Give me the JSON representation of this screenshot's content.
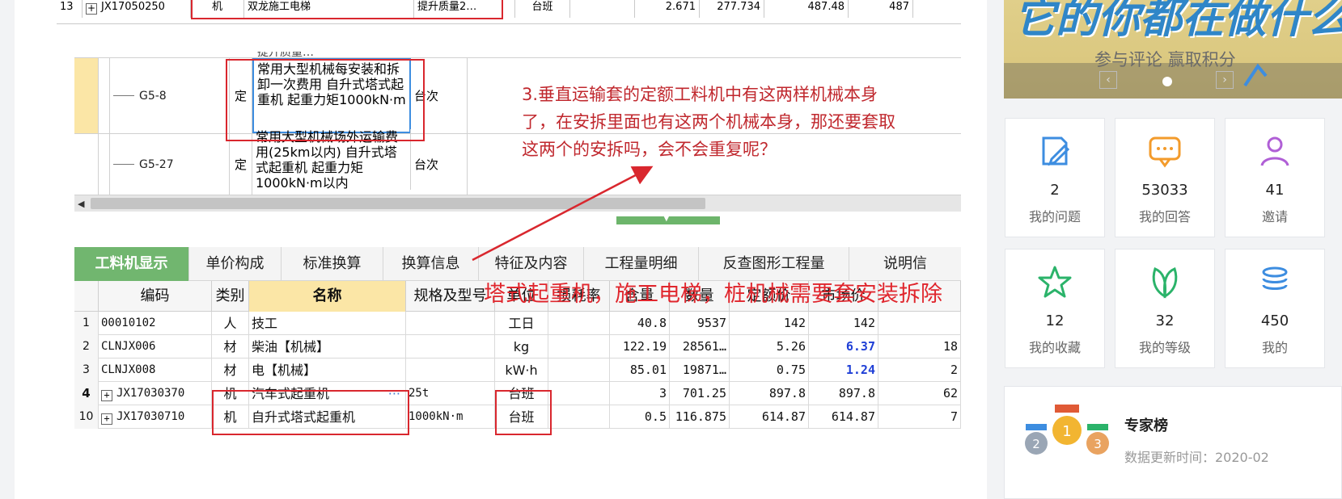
{
  "top_strip": {
    "row_no": "13",
    "code": "JX17050250",
    "type": "机",
    "name": "双龙施工电梯",
    "spec": "提升质量2…",
    "unit": "台班",
    "qty": "2.671",
    "amount": "277.734",
    "price": "487.48",
    "price2": "487"
  },
  "quota_rows": [
    {
      "code": "G5-8",
      "type": "定",
      "name": "常用大型机械每安装和拆卸一次费用 自升式塔式起重机 起重力矩1000kN·m",
      "unit": "台次"
    },
    {
      "code": "G5-27",
      "type": "定",
      "name": "常用大型机械场外运输费用(25km以内) 自升式塔式起重机 起重力矩1000kN·m以内",
      "unit": "台次"
    }
  ],
  "quota_cut_text": "提升质量…",
  "annotation": "3.垂直运输套的定额工料机中有这两样机械本身了，在安拆里面也有这两个机械本身，那还要套取这两个的安拆吗，会不会重复呢？",
  "tabs": [
    "工料机显示",
    "单价构成",
    "标准换算",
    "换算信息",
    "特征及内容",
    "工程量明细",
    "反查图形工程量",
    "说明信"
  ],
  "grid": {
    "headers": [
      "编码",
      "类别",
      "名称",
      "规格及型号",
      "单位",
      "损耗率",
      "含量",
      "数量",
      "定额价",
      "市场价"
    ],
    "rows": [
      {
        "idx": "1",
        "code": "00010102",
        "type": "人",
        "name": "技工",
        "spec": "",
        "unit": "工日",
        "loss": "",
        "content": "40.8",
        "qty": "9537",
        "quota_price": "142",
        "market_price": "142",
        "extra": ""
      },
      {
        "idx": "2",
        "code": "CLNJX006",
        "type": "材",
        "name": "柴油【机械】",
        "spec": "",
        "unit": "kg",
        "loss": "",
        "content": "122.19",
        "qty": "28561…",
        "quota_price": "5.26",
        "market_price": "6.37",
        "extra": "18"
      },
      {
        "idx": "3",
        "code": "CLNJX008",
        "type": "材",
        "name": "电【机械】",
        "spec": "",
        "unit": "kW·h",
        "loss": "",
        "content": "85.01",
        "qty": "19871…",
        "quota_price": "0.75",
        "market_price": "1.24",
        "extra": "2"
      },
      {
        "idx": "4",
        "code": "JX17030370",
        "type": "机",
        "name": "汽车式起重机",
        "spec": "25t",
        "unit": "台班",
        "loss": "",
        "content": "3",
        "qty": "701.25",
        "quota_price": "897.8",
        "market_price": "897.8",
        "extra": "62"
      },
      {
        "idx": "10",
        "code": "JX17030710",
        "type": "机",
        "name": "自升式塔式起重机",
        "spec": "1000kN·m",
        "unit": "台班",
        "loss": "",
        "content": "0.5",
        "qty": "116.875",
        "quota_price": "614.87",
        "market_price": "614.87",
        "extra": "7"
      }
    ]
  },
  "overlay_text": "塔式起重机，施工电梯，桩机械需要套安装拆除",
  "sidebar": {
    "banner_title": "它的你都在做什么",
    "banner_sub": "参与评论 赢取积分",
    "stats_row1": [
      {
        "num": "2",
        "label": "我的问题",
        "icon": "edit-icon",
        "color": "#3d8de0"
      },
      {
        "num": "53033",
        "label": "我的回答",
        "icon": "chat-icon",
        "color": "#f39b2b"
      },
      {
        "num": "41",
        "label": "邀请",
        "icon": "user-icon",
        "color": "#b05fd6"
      }
    ],
    "stats_row2": [
      {
        "num": "12",
        "label": "我的收藏",
        "icon": "star-icon",
        "color": "#2bb36a"
      },
      {
        "num": "32",
        "label": "我的等级",
        "icon": "leaf-icon",
        "color": "#2bb36a"
      },
      {
        "num": "450",
        "label": "我的",
        "icon": "coins-icon",
        "color": "#3d8de0"
      }
    ],
    "expert_title": "专家榜",
    "expert_time": "数据更新时间：2020-02"
  }
}
